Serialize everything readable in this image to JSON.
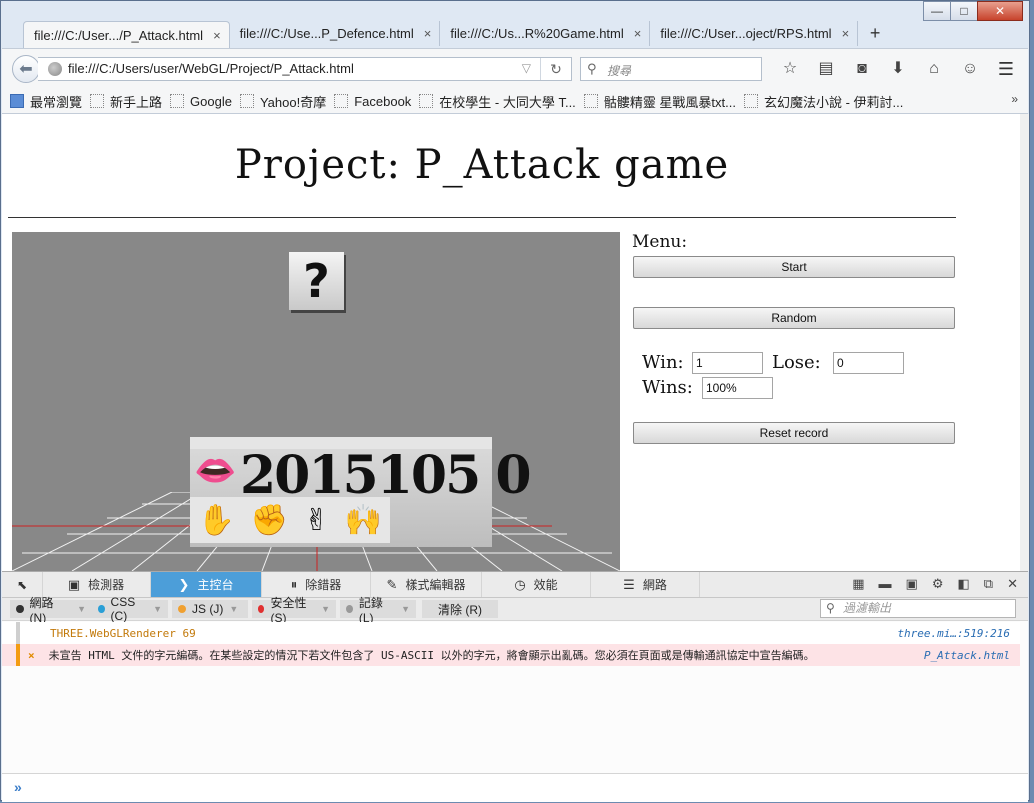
{
  "window": {
    "minimize": "—",
    "maximize": "□",
    "close": "✕"
  },
  "tabs": [
    {
      "label": "file:///C:/User.../P_Attack.html",
      "active": true
    },
    {
      "label": "file:///C:/Use...P_Defence.html",
      "active": false
    },
    {
      "label": "file:///C:/Us...R%20Game.html",
      "active": false
    },
    {
      "label": "file:///C:/User...oject/RPS.html",
      "active": false
    }
  ],
  "tab_close": "×",
  "new_tab": "+",
  "navbar": {
    "url": "file:///C:/Users/user/WebGL/Project/P_Attack.html",
    "search_placeholder": "搜尋"
  },
  "bookmarks": [
    "最常瀏覽",
    "新手上路",
    "Google",
    "Yahoo!奇摩",
    "Facebook",
    "在校學生 - 大同大學 T...",
    "骷髏精靈 星戰風暴txt...",
    "玄幻魔法小說 - 伊莉討..."
  ],
  "page": {
    "title": "Project: P_Attack game",
    "menu_label": "Menu:",
    "start_label": "Start",
    "random_label": "Random",
    "win_label": "Win:",
    "win_value": "1",
    "lose_label": "Lose:",
    "lose_value": "0",
    "wins_label": "Wins:",
    "wins_value": "100%",
    "reset_label": "Reset record"
  },
  "scene": {
    "question_mark": "?",
    "cube_text": "2015105 0",
    "lips_glyph": "👄",
    "hand_glyphs": [
      "✋",
      "✊",
      "✌",
      "🙌"
    ]
  },
  "devtools": {
    "tabs": [
      {
        "icon": "▣",
        "label": "檢測器",
        "active": false
      },
      {
        "icon": "❯",
        "label": "主控台",
        "active": true
      },
      {
        "icon": "⏸",
        "label": "除錯器",
        "active": false
      },
      {
        "icon": "✎",
        "label": "樣式編輯器",
        "active": false
      },
      {
        "icon": "◷",
        "label": "效能",
        "active": false
      },
      {
        "icon": "☰",
        "label": "網路",
        "active": false
      }
    ],
    "filters": [
      {
        "label": "網路 (N)",
        "color": "#333333"
      },
      {
        "label": "CSS (C)",
        "color": "#2a9fd6"
      },
      {
        "label": "JS (J)",
        "color": "#f0a030"
      },
      {
        "label": "安全性 (S)",
        "color": "#e03030"
      },
      {
        "label": "記錄 (L)",
        "color": "#999999"
      }
    ],
    "clear_label": "清除 (R)",
    "filter_placeholder": "過濾輸出",
    "logs": [
      {
        "message": "THREE.WebGLRenderer 69",
        "source": "three.mi…:519:216",
        "type": "log"
      },
      {
        "message": "未宣告 HTML 文件的字元編碼。在某些設定的情況下若文件包含了 US-ASCII 以外的字元，將會顯示出亂碼。您必須在頁面或是傳輸通訊協定中宣告編碼。",
        "source": "P_Attack.html",
        "type": "error",
        "icon": "×"
      }
    ],
    "prompt": "»"
  }
}
